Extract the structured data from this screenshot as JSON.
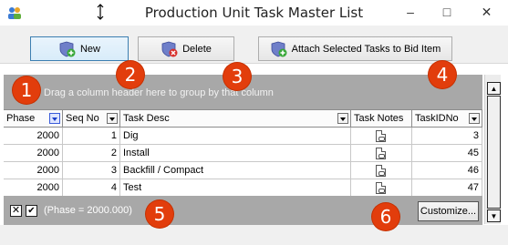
{
  "window": {
    "title": "Production Unit Task Master List",
    "minimize_glyph": "–",
    "maximize_glyph": "□",
    "close_glyph": "✕"
  },
  "toolbar": {
    "new_label": "New",
    "delete_label": "Delete",
    "attach_label": "Attach Selected Tasks to Bid Item"
  },
  "group_panel": {
    "hint": "Drag a column header here to group by that column"
  },
  "grid": {
    "columns": [
      "Phase",
      "Seq No",
      "Task Desc",
      "Task Notes",
      "TaskIDNo"
    ],
    "rows": [
      {
        "phase": "2000",
        "seq": "1",
        "desc": "Dig",
        "id": "3"
      },
      {
        "phase": "2000",
        "seq": "2",
        "desc": "Install",
        "id": "45"
      },
      {
        "phase": "2000",
        "seq": "3",
        "desc": "Backfill / Compact",
        "id": "46"
      },
      {
        "phase": "2000",
        "seq": "4",
        "desc": "Test",
        "id": "47"
      }
    ]
  },
  "filter_bar": {
    "x_glyph": "✕",
    "check_glyph": "✔",
    "filter_text": "(Phase = 2000.000)",
    "customize_label": "Customize..."
  },
  "scrollbar": {
    "up_glyph": "▲",
    "down_glyph": "▼"
  },
  "callouts": [
    "1",
    "2",
    "3",
    "4",
    "5",
    "6"
  ],
  "colors": {
    "callout": "#e23d0c",
    "panel_gray": "#a8a8a8",
    "active_button": "#d8ecfa"
  },
  "icons": {
    "app": "app-people-icon",
    "new": "shield-add-icon",
    "delete": "shield-remove-icon",
    "attach": "shield-add-icon",
    "note": "note-icon"
  }
}
